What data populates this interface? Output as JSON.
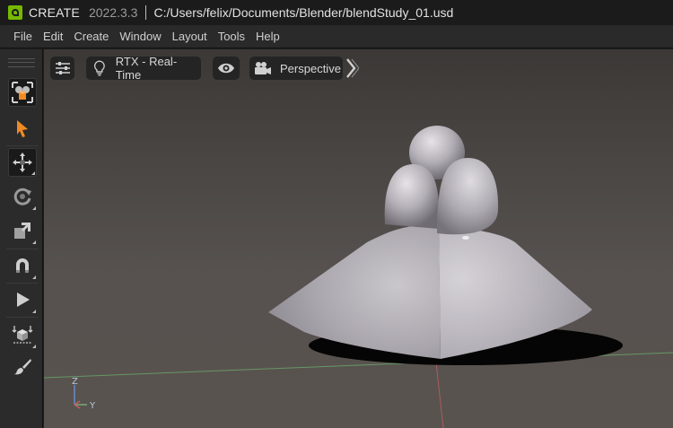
{
  "titlebar": {
    "app_name": "CREATE",
    "version": "2022.3.3",
    "file_path": "C:/Users/felix/Documents/Blender/blendStudy_01.usd",
    "logo_icon": "nvidia-logo-icon"
  },
  "menu": {
    "items": [
      "File",
      "Edit",
      "Create",
      "Window",
      "Layout",
      "Tools",
      "Help"
    ]
  },
  "toolbar": {
    "tools": [
      {
        "name": "select-mode-icon",
        "selected": false
      },
      {
        "name": "select-arrow-icon",
        "selected": false
      },
      {
        "name": "move-icon",
        "selected": true
      },
      {
        "name": "rotate-icon",
        "selected": false
      },
      {
        "name": "scale-icon",
        "selected": false
      },
      {
        "name": "snap-magnet-icon",
        "selected": false
      },
      {
        "name": "play-icon",
        "selected": false
      },
      {
        "name": "drop-to-floor-icon",
        "selected": false
      },
      {
        "name": "paint-brush-icon",
        "selected": false
      }
    ],
    "accent_color": "#f08a24"
  },
  "viewport": {
    "renderer_label": "RTX - Real-Time",
    "camera_label": "Perspective",
    "axis": {
      "z": "Z",
      "y": "Y"
    },
    "icons": [
      "settings-sliders-icon",
      "lightbulb-icon",
      "eye-icon",
      "camera-icon",
      "expand-chevron-icon"
    ],
    "grid_x_axis_color": "#6aa86a",
    "grid_y_axis_color": "#c06060",
    "mesh_color": "#b8b4be"
  }
}
